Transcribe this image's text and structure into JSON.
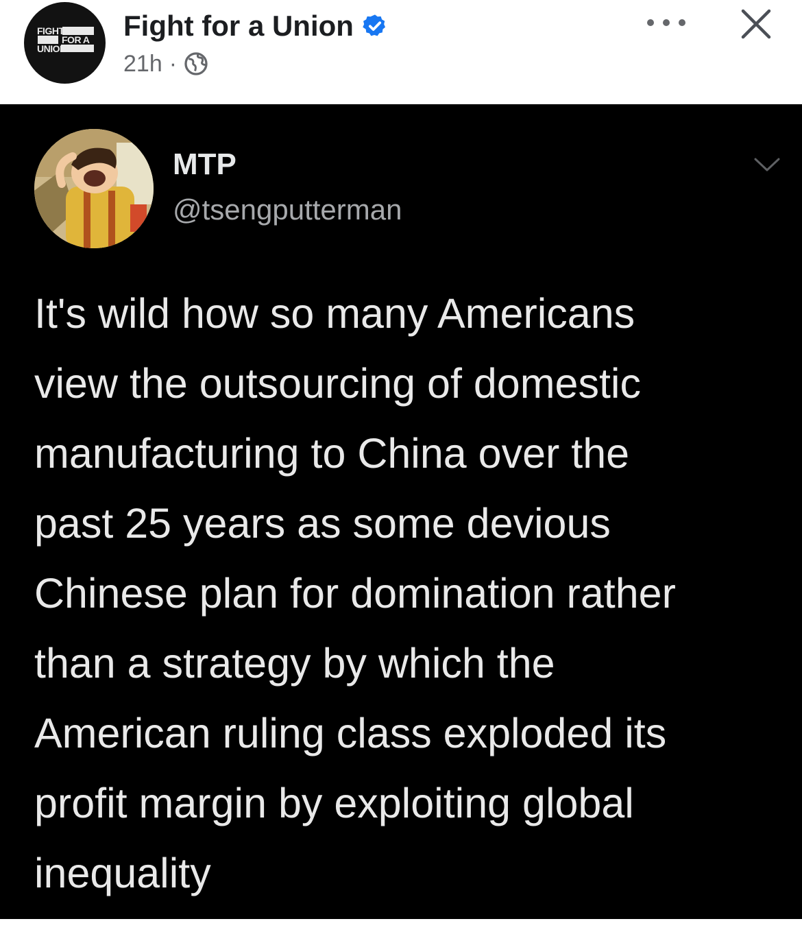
{
  "post_header": {
    "page_name": "Fight for a Union",
    "timestamp": "21h",
    "separator": "·",
    "avatar_text": [
      "FIGHT",
      "FOR A",
      "UNION"
    ],
    "icons": {
      "verified": "verified-badge-icon",
      "audience": "globe-icon",
      "more": "more-options-icon",
      "close": "close-icon"
    },
    "colors": {
      "verified": "#1877f2",
      "text": "#1c1e21",
      "secondary": "#65676b"
    }
  },
  "tweet": {
    "display_name": "MTP",
    "handle": "@tsengputterman",
    "chevron_icon": "chevron-down-icon",
    "lines": [
      "It's wild how so many Americans",
      "view the outsourcing of domestic",
      "manufacturing to China over the",
      "past 25 years as some devious",
      "Chinese plan for domination rather",
      "than a strategy by which the",
      "American ruling class exploded its",
      "profit margin by exploiting global",
      "inequality"
    ],
    "colors": {
      "background": "#000000",
      "text": "#e9e9e9"
    }
  }
}
